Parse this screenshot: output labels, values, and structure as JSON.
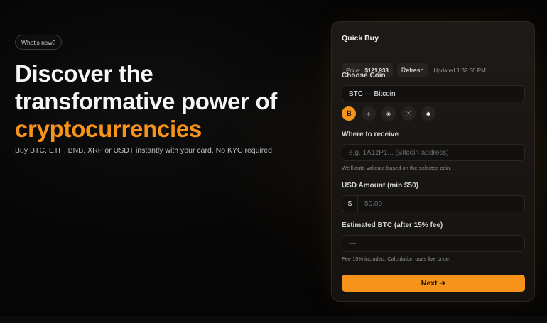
{
  "hero": {
    "badge": "What's new?",
    "title_line1": "Discover the",
    "title_line2": "transformative power of",
    "title_accent": "cryptocurrencies",
    "subtitle": "Buy BTC, ETH, BNB, XRP or USDT instantly with your card. No KYC required."
  },
  "card": {
    "title": "Quick Buy",
    "price_label": "Price:",
    "price_value": "$121,933",
    "refresh_label": "Refresh",
    "updated_text": "Updated 1:32:56 PM",
    "choose_coin_label": "Choose Coin",
    "selected_coin": "BTC — Bitcoin",
    "coins": [
      {
        "icon": "bitcoin-icon",
        "glyph": "₿",
        "active": true
      },
      {
        "icon": "ethereum-icon",
        "glyph": "⬨",
        "active": false
      },
      {
        "icon": "bnb-icon",
        "glyph": "◈",
        "active": false
      },
      {
        "icon": "xrp-icon",
        "glyph": "(×)",
        "active": false
      },
      {
        "icon": "usdt-gem-icon",
        "glyph": "◆",
        "active": false
      }
    ],
    "receive_label": "Where to receive",
    "receive_placeholder": "e.g. 1A1zP1... (Bitcoin address)",
    "receive_hint": "We'll auto-validate based on the selected coin.",
    "usd_label": "USD Amount (min $50)",
    "usd_prefix": "$",
    "usd_placeholder": "50.00",
    "estimate_label": "Estimated BTC (after 15% fee)",
    "estimate_value": "—",
    "fee_hint": "Fee 15% included. Calculation uses live price.",
    "next_label": "Next ➔"
  },
  "colors": {
    "accent": "#f7931a",
    "background": "#050505",
    "card": "#1b1815"
  }
}
